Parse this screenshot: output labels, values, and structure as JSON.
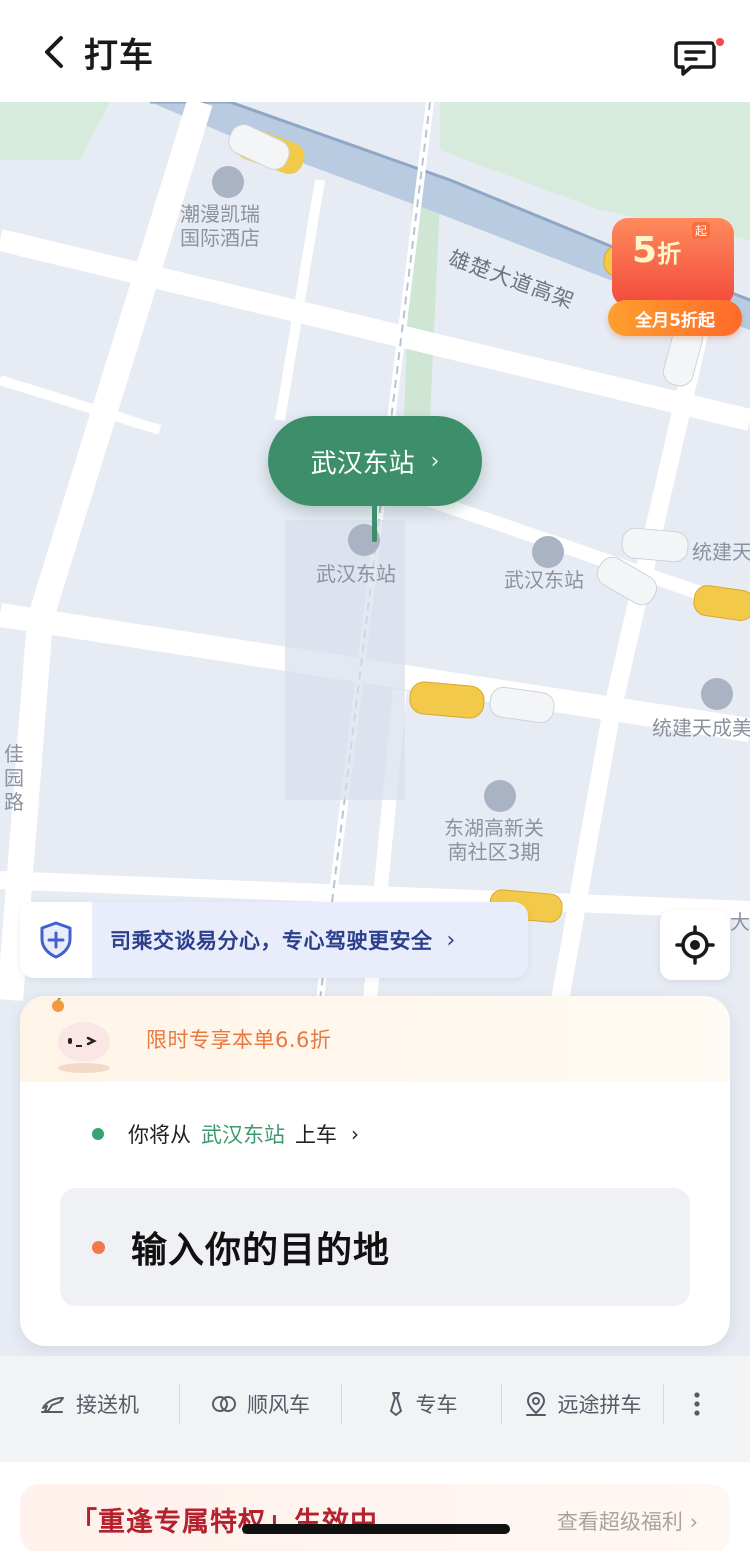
{
  "header": {
    "title": "打车",
    "back_icon": "chevron-left-icon",
    "message_icon": "chat-icon",
    "has_unread": true
  },
  "map": {
    "labels": {
      "hotel": "潮漫凯瑞\n国际酒店",
      "road_elevated": "雄楚大道高架",
      "station_poi": "武汉东站",
      "station_poi_2": "武汉东站",
      "tongjian_top": "统建天",
      "tongjian_cheng": "统建天成美",
      "jiayuan_road": "佳\n园\n路",
      "donghu": "东湖高新关\n南社区3期",
      "right_edge": "聪我大"
    },
    "pickup_pin": {
      "label": "武汉东站",
      "chevron": "›"
    },
    "promo": {
      "big": "5",
      "big_unit": "折",
      "tag": "起",
      "bottom": "全月5折起"
    }
  },
  "safety_banner": {
    "text": "司乘交谈易分心，专心驾驶更安全",
    "chevron": "›",
    "icon": "shield-plus-icon"
  },
  "locate_button": {
    "icon": "locate-icon"
  },
  "panel": {
    "promo_text": "限时专享本单6.6折",
    "from_prefix": "你将从",
    "from_station": "武汉东站",
    "from_suffix": "上车",
    "from_chevron": "›",
    "destination_placeholder": "输入你的目的地"
  },
  "services": [
    {
      "label": "接送机",
      "icon": "plane-icon"
    },
    {
      "label": "顺风车",
      "icon": "hitch-icon"
    },
    {
      "label": "专车",
      "icon": "tie-icon"
    },
    {
      "label": "远途拼车",
      "icon": "map-pin-icon"
    }
  ],
  "more_icon": "more-vertical-icon",
  "bottom_card": {
    "title": "「重逢专属特权」生效中",
    "link": "查看超级福利 ›"
  },
  "colors": {
    "accent_green": "#3d8f6c",
    "promo_orange": "#e9793e",
    "safety_blue": "#2b3f8c",
    "brand_red": "#b3222d"
  }
}
